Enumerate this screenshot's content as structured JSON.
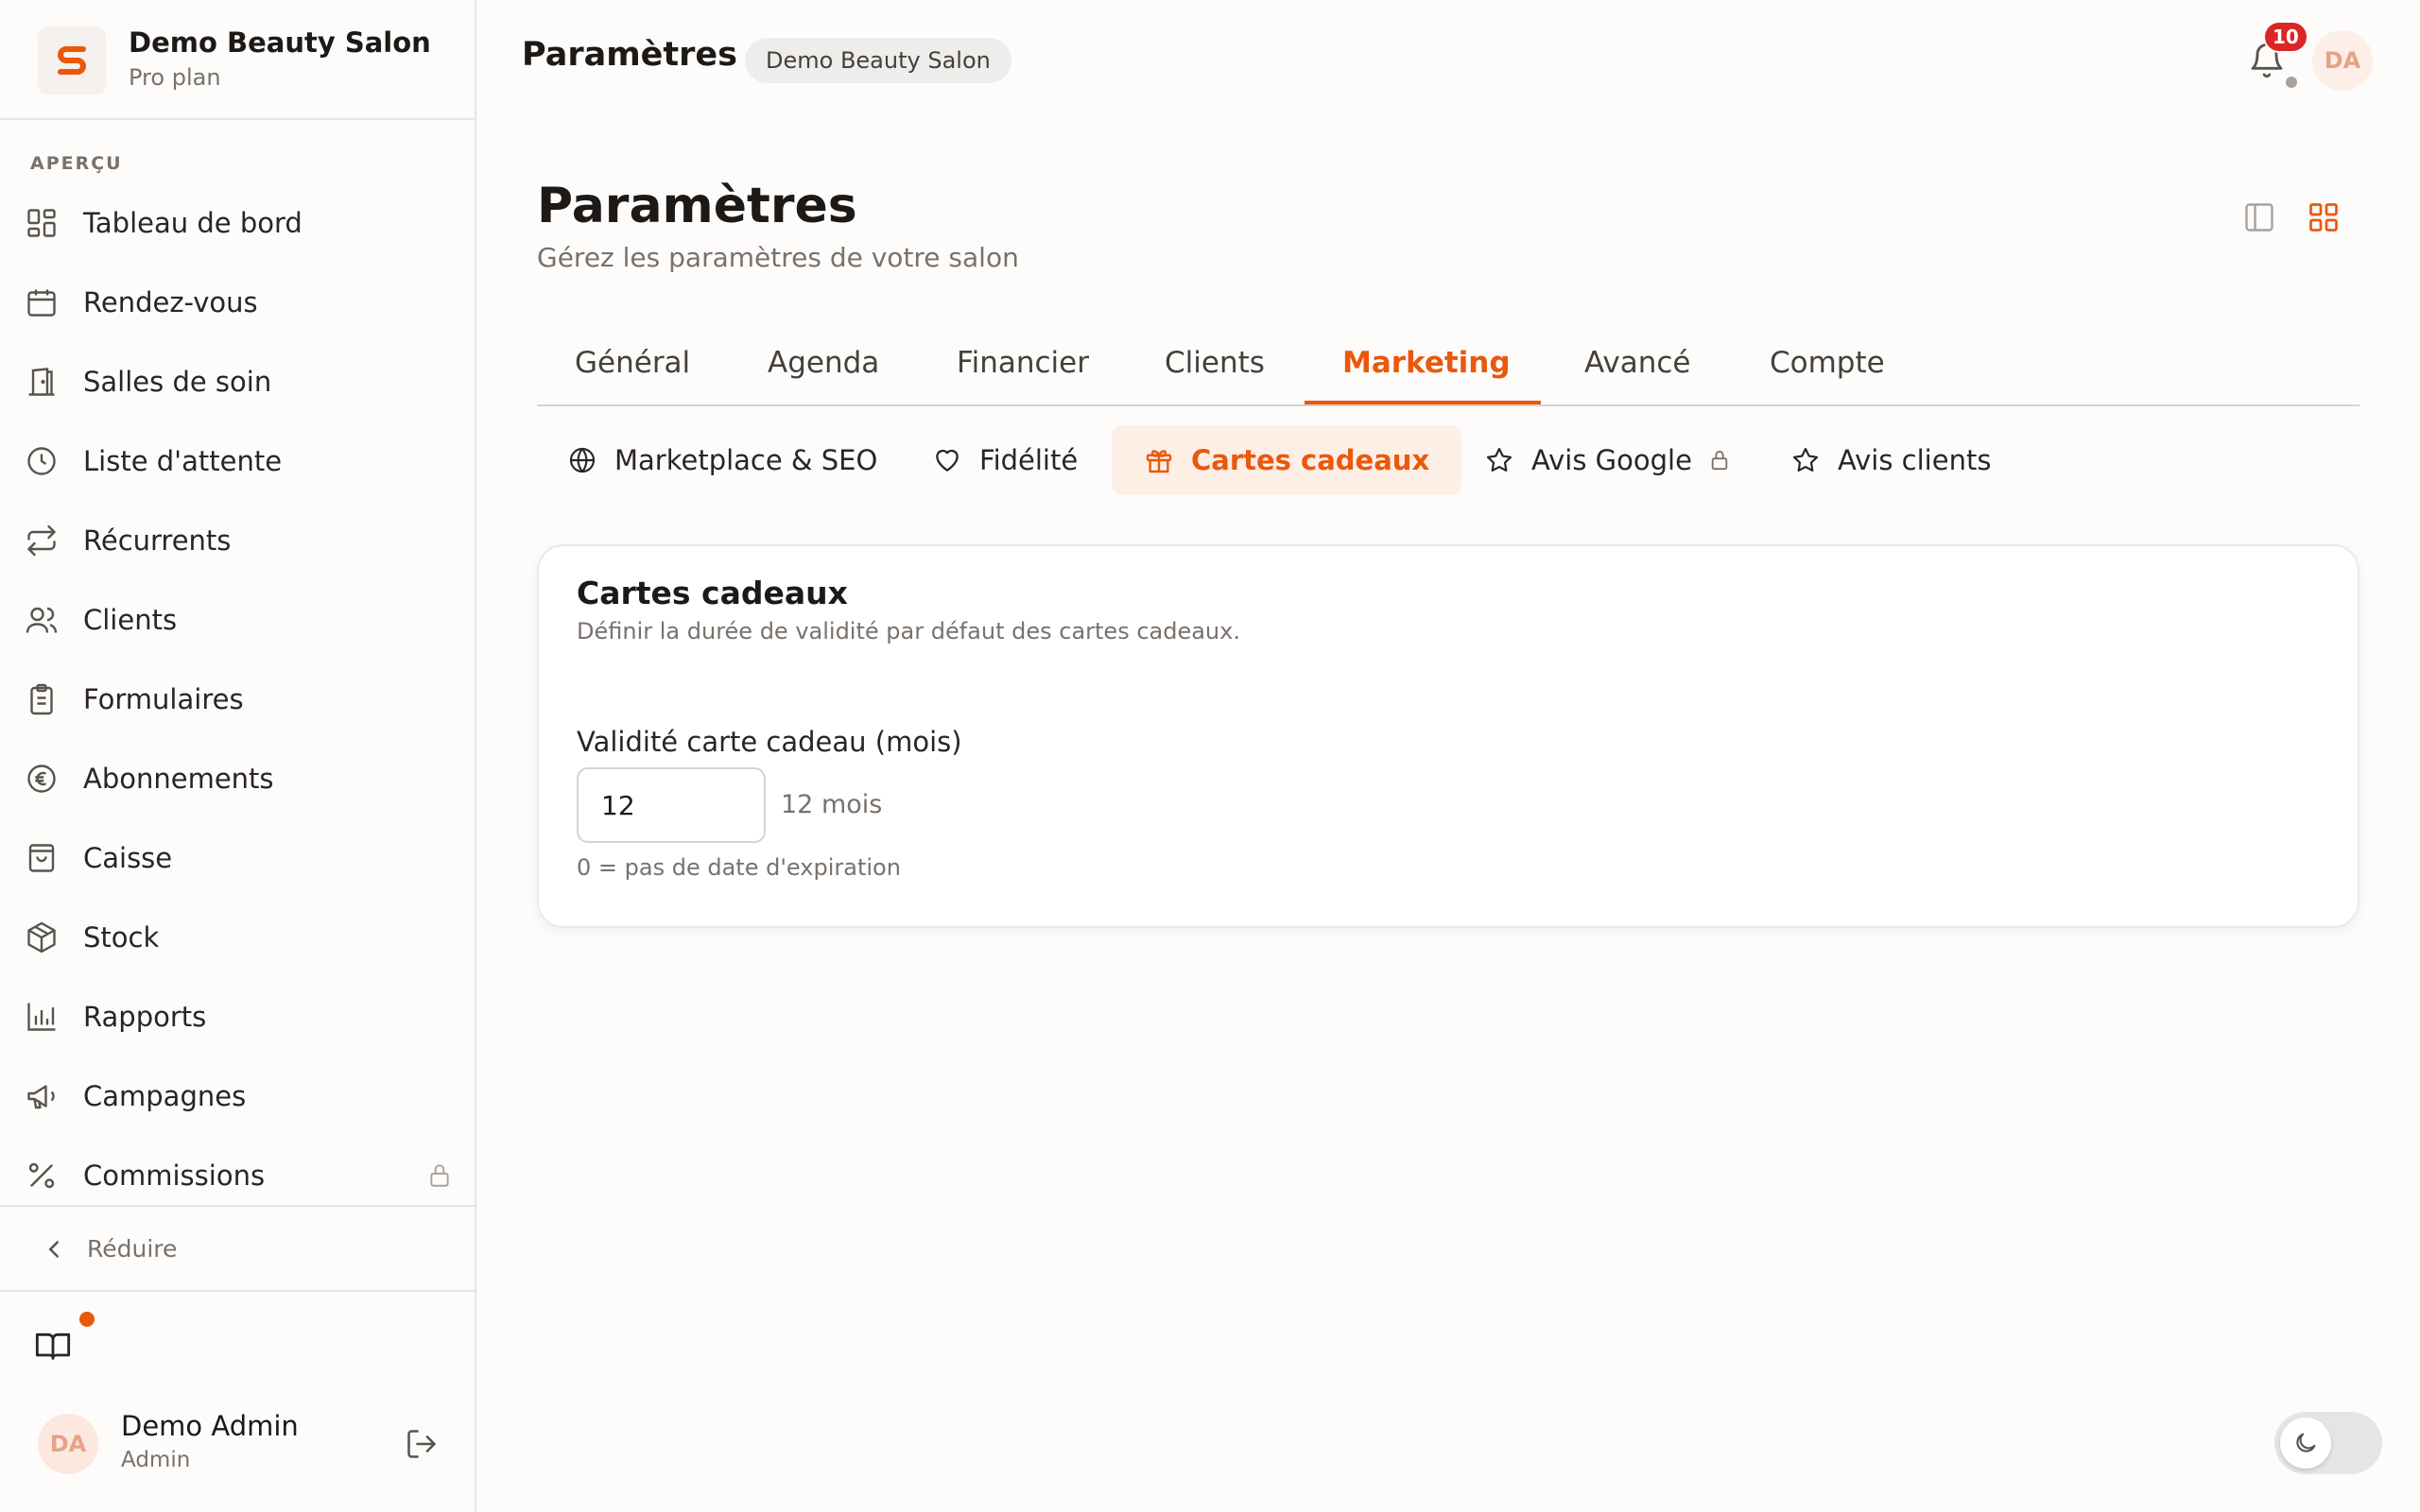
{
  "brand": {
    "name": "Demo Beauty Salon",
    "plan": "Pro plan",
    "logo_letter": "S",
    "accent": "#ea580c"
  },
  "sidebar": {
    "section_label": "APERÇU",
    "items": [
      {
        "label": "Tableau de bord",
        "icon": "dashboard-icon"
      },
      {
        "label": "Rendez-vous",
        "icon": "calendar-icon"
      },
      {
        "label": "Salles de soin",
        "icon": "door-icon"
      },
      {
        "label": "Liste d'attente",
        "icon": "clock-icon"
      },
      {
        "label": "Récurrents",
        "icon": "repeat-icon"
      },
      {
        "label": "Clients",
        "icon": "users-icon"
      },
      {
        "label": "Formulaires",
        "icon": "clipboard-icon"
      },
      {
        "label": "Abonnements",
        "icon": "euro-icon"
      },
      {
        "label": "Caisse",
        "icon": "shopping-bag-icon"
      },
      {
        "label": "Stock",
        "icon": "package-icon"
      },
      {
        "label": "Rapports",
        "icon": "bar-chart-icon"
      },
      {
        "label": "Campagnes",
        "icon": "megaphone-icon"
      },
      {
        "label": "Commissions",
        "icon": "percent-icon",
        "locked": true
      }
    ],
    "collapse_label": "Réduire",
    "user": {
      "initials": "DA",
      "name": "Demo Admin",
      "role": "Admin"
    }
  },
  "header": {
    "title": "Paramètres",
    "salon_chip": "Demo Beauty Salon",
    "notifications_count": "10",
    "avatar_initials": "DA"
  },
  "page": {
    "title": "Paramètres",
    "subtitle": "Gérez les paramètres de votre salon"
  },
  "tabs": [
    {
      "label": "Général"
    },
    {
      "label": "Agenda"
    },
    {
      "label": "Financier"
    },
    {
      "label": "Clients"
    },
    {
      "label": "Marketing",
      "active": true
    },
    {
      "label": "Avancé"
    },
    {
      "label": "Compte"
    }
  ],
  "subtabs": [
    {
      "label": "Marketplace & SEO",
      "icon": "globe-icon"
    },
    {
      "label": "Fidélité",
      "icon": "heart-icon"
    },
    {
      "label": "Cartes cadeaux",
      "icon": "gift-icon",
      "active": true
    },
    {
      "label": "Avis Google",
      "icon": "star-icon",
      "locked": true
    },
    {
      "label": "Avis clients",
      "icon": "star-icon"
    }
  ],
  "card": {
    "title": "Cartes cadeaux",
    "description": "Définir la durée de validité par défaut des cartes cadeaux.",
    "field_label": "Validité carte cadeau (mois)",
    "field_value": "12",
    "field_suffix": "12 mois",
    "field_hint": "0 = pas de date d'expiration"
  },
  "theme": {
    "mode": "light",
    "toggle_icon": "moon-icon"
  }
}
